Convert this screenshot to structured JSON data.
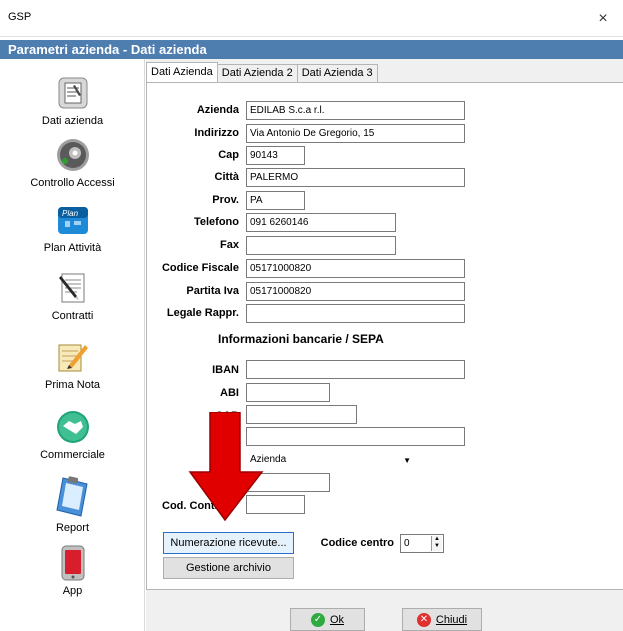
{
  "window": {
    "app_title": "GSP",
    "close_glyph": "×"
  },
  "header": {
    "title": "Parametri azienda - Dati azienda"
  },
  "sidebar": {
    "items": [
      {
        "label": "Dati azienda",
        "icon": "document-icon"
      },
      {
        "label": "Controllo Accessi",
        "icon": "speaker-icon"
      },
      {
        "label": "Plan Attività",
        "icon": "plan-icon"
      },
      {
        "label": "Contratti",
        "icon": "contract-pen-icon"
      },
      {
        "label": "Prima Nota",
        "icon": "notepad-pencil-icon"
      },
      {
        "label": "Commerciale",
        "icon": "handshake-icon"
      },
      {
        "label": "Report",
        "icon": "clipboard-icon"
      },
      {
        "label": "App",
        "icon": "mobile-phone-icon"
      }
    ]
  },
  "tabs": [
    {
      "label": "Dati Azienda",
      "active": true
    },
    {
      "label": "Dati Azienda 2",
      "active": false
    },
    {
      "label": "Dati Azienda 3",
      "active": false
    }
  ],
  "form": {
    "azienda": {
      "label": "Azienda",
      "value": "EDILAB S.c.a r.l."
    },
    "indirizzo": {
      "label": "Indirizzo",
      "value": "Via Antonio De Gregorio, 15"
    },
    "cap": {
      "label": "Cap",
      "value": "90143"
    },
    "citta": {
      "label": "Città",
      "value": "PALERMO"
    },
    "prov": {
      "label": "Prov.",
      "value": "PA"
    },
    "telefono": {
      "label": "Telefono",
      "value": "091 6260146"
    },
    "fax": {
      "label": "Fax",
      "value": ""
    },
    "codice_fiscale": {
      "label": "Codice Fiscale",
      "value": "05171000820"
    },
    "partita_iva": {
      "label": "Partita Iva",
      "value": "05171000820"
    },
    "legale_rappr": {
      "label": "Legale Rappr.",
      "value": ""
    }
  },
  "bank": {
    "title": "Informazioni bancarie / SEPA",
    "iban": {
      "label": "IBAN",
      "value": ""
    },
    "abi": {
      "label": "ABI",
      "value": ""
    },
    "cab": {
      "label": "CAB",
      "value": ""
    },
    "id_univoco": {
      "label": "ID Ur",
      "value": ""
    },
    "tipo": {
      "label": "Tip",
      "value": "Azienda"
    },
    "codice": {
      "label": "Codi",
      "value": ""
    },
    "cod_contr": {
      "label": "Cod. Contr",
      "value": ""
    }
  },
  "buttons": {
    "numerazione": "Numerazione ricevute...",
    "gestione": "Gestione archivio",
    "ok": "Ok",
    "chiudi": "Chiudi"
  },
  "codice_centro": {
    "label": "Codice centro",
    "value": "0"
  },
  "colors": {
    "header_bg": "#4e7db0",
    "arrow_red": "#e00000"
  }
}
